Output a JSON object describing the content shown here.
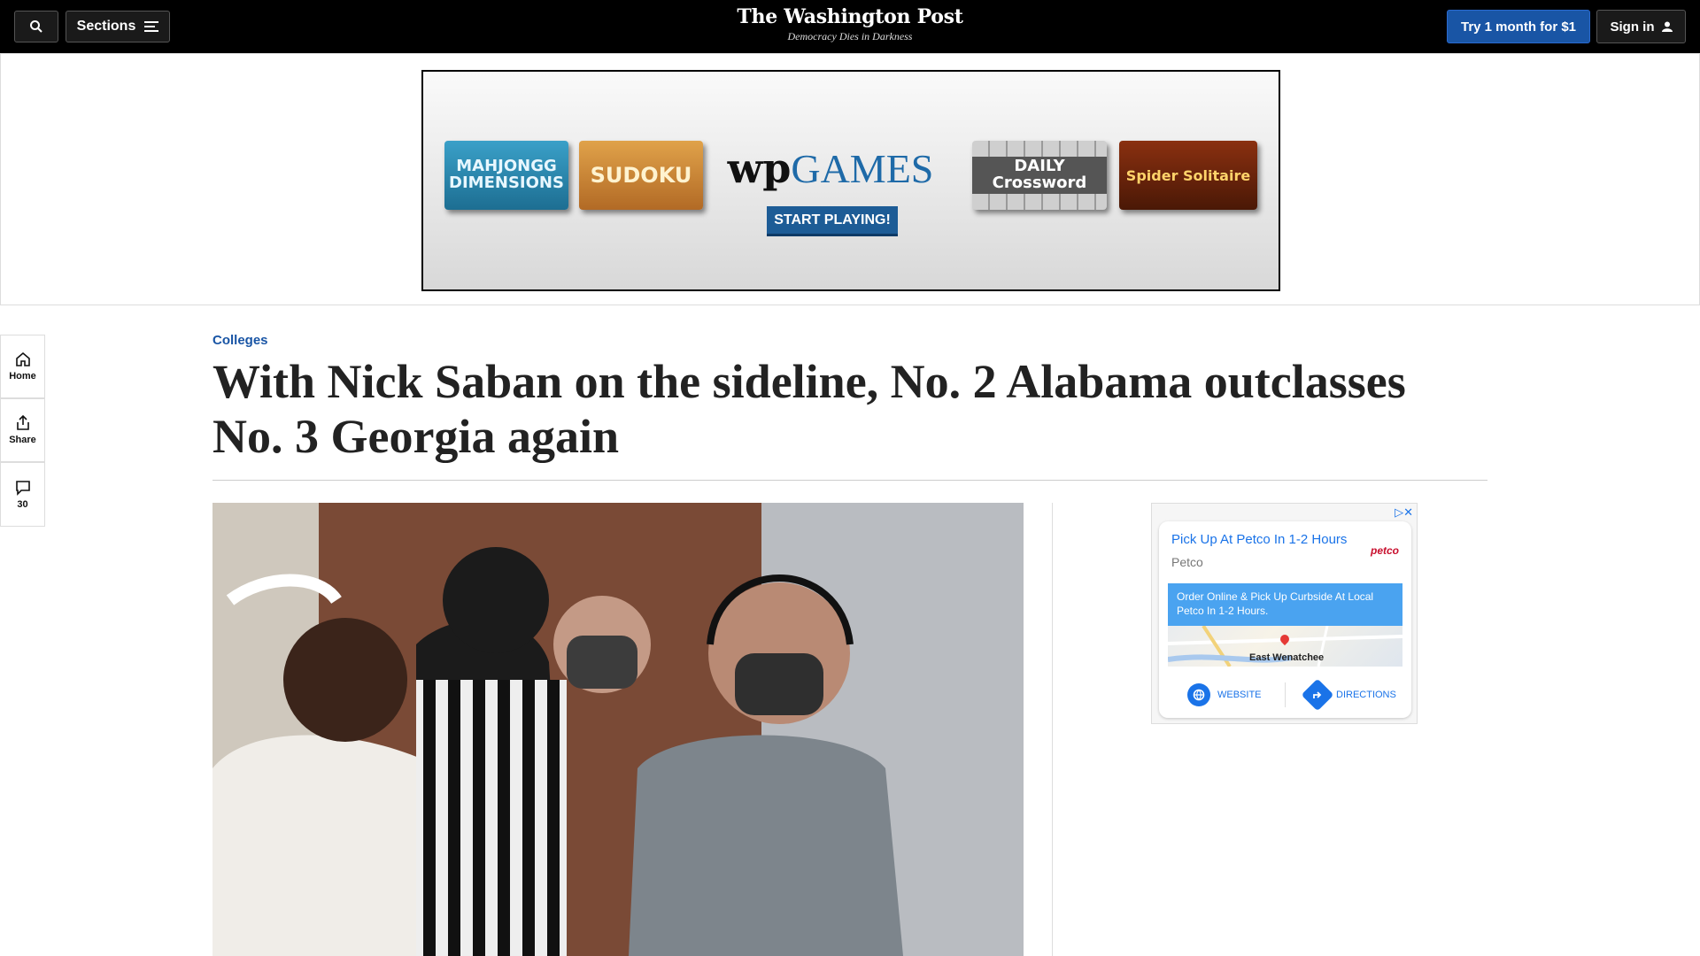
{
  "header": {
    "sections_label": "Sections",
    "logo": "The Washington Post",
    "tagline": "Democracy Dies in Darkness",
    "try_label": "Try 1 month for $1",
    "signin_label": "Sign in"
  },
  "games_ad": {
    "tiles": [
      "MAHJONGG DIMENSIONS",
      "SUDOKU",
      "DAILY Crossword",
      "Spider Solitaire"
    ],
    "brand_wp": "wp",
    "brand_games": "GAMES",
    "cta": "START PLAYING!"
  },
  "rail": {
    "home_label": "Home",
    "share_label": "Share",
    "comments_count": "30"
  },
  "article": {
    "kicker": "Colleges",
    "headline": "With Nick Saban on the sideline, No. 2 Alabama outclasses No. 3 Georgia again"
  },
  "petco_ad": {
    "title": "Pick Up At Petco In 1-2 Hours",
    "brand": "Petco",
    "logo_text": "petco",
    "description": "Order Online & Pick Up Curbside At Local Petco In 1-2 Hours.",
    "map_city": "East Wenatchee",
    "website_label": "WEBSITE",
    "directions_label": "DIRECTIONS"
  },
  "colors": {
    "topbar": "#000000",
    "accent_blue": "#1955a5",
    "ad_link_blue": "#1a73e8"
  }
}
